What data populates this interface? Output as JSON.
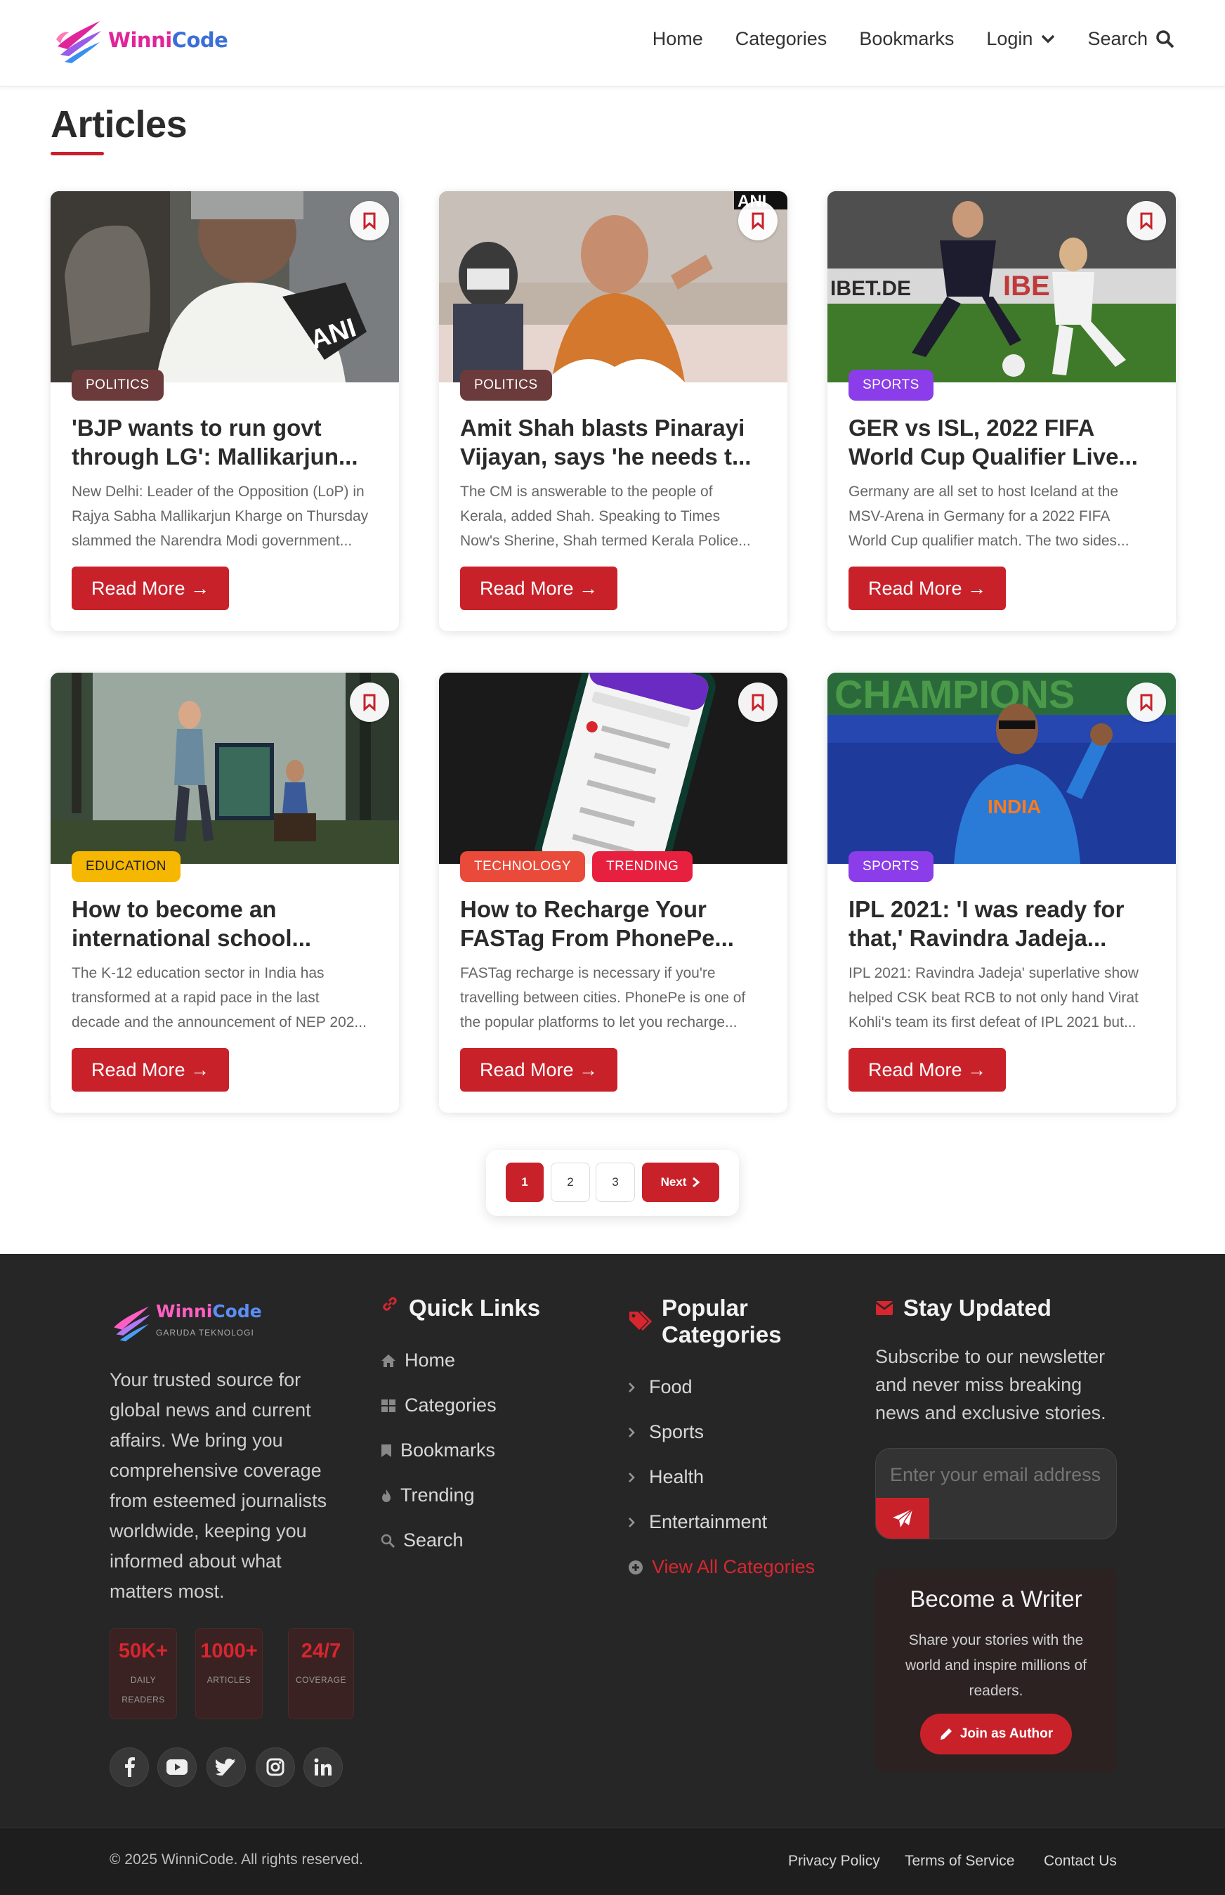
{
  "brand": {
    "name_part1": "Winni",
    "name_part2": "Code",
    "subtitle": "GARUDA TEKNOLOGI"
  },
  "nav": {
    "home": "Home",
    "categories": "Categories",
    "bookmarks": "Bookmarks",
    "login": "Login",
    "search": "Search"
  },
  "page": {
    "title": "Articles"
  },
  "articles": [
    {
      "tags": [
        "POLITICS"
      ],
      "tag_colors": [
        "#6b3b3b"
      ],
      "title_lines": [
        "'BJP wants to run govt",
        "through LG': Mallikarjun..."
      ],
      "excerpt_lines": [
        "New Delhi: Leader of the Opposition (LoP) in",
        "Rajya Sabha Mallikarjun Kharge on Thursday",
        "slammed the Narendra Modi government..."
      ],
      "read_more": "Read More →"
    },
    {
      "tags": [
        "POLITICS"
      ],
      "tag_colors": [
        "#6b3b3b"
      ],
      "title_lines": [
        "Amit Shah blasts Pinarayi",
        "Vijayan, says 'he needs t..."
      ],
      "excerpt_lines": [
        "The CM is answerable to the people of",
        "Kerala, added Shah. Speaking to Times",
        "Now's Sherine, Shah termed Kerala Police..."
      ],
      "read_more": "Read More →"
    },
    {
      "tags": [
        "SPORTS"
      ],
      "tag_colors": [
        "#8a3de8"
      ],
      "title_lines": [
        "GER vs ISL, 2022 FIFA",
        "World Cup Qualifier Live..."
      ],
      "excerpt_lines": [
        "Germany are all set to host Iceland at the",
        "MSV-Arena in Germany for a 2022 FIFA",
        "World Cup qualifier match. The two sides..."
      ],
      "read_more": "Read More →"
    },
    {
      "tags": [
        "EDUCATION"
      ],
      "tag_colors": [
        "#f5b700"
      ],
      "title_lines": [
        "How to become an",
        "international school..."
      ],
      "excerpt_lines": [
        "The K-12 education sector in India has",
        "transformed at a rapid pace in the last",
        "decade and the announcement of NEP 202..."
      ],
      "read_more": "Read More →"
    },
    {
      "tags": [
        "TECHNOLOGY",
        "TRENDING"
      ],
      "tag_colors": [
        "#e94a3a",
        "#e8203f"
      ],
      "title_lines": [
        "How to Recharge Your",
        "FASTag From PhonePe..."
      ],
      "excerpt_lines": [
        "FASTag recharge is necessary if you're",
        "travelling between cities. PhonePe is one of",
        "the popular platforms to let you recharge..."
      ],
      "read_more": "Read More →"
    },
    {
      "tags": [
        "SPORTS"
      ],
      "tag_colors": [
        "#8a3de8"
      ],
      "title_lines": [
        "IPL 2021: 'I was ready for",
        "that,' Ravindra Jadeja..."
      ],
      "excerpt_lines": [
        "IPL 2021: Ravindra Jadeja' superlative show",
        "helped CSK beat RCB to not only hand Virat",
        "Kohli's team its first defeat of IPL 2021 but..."
      ],
      "read_more": "Read More →"
    }
  ],
  "pagination": {
    "pages": [
      "1",
      "2",
      "3"
    ],
    "current": "1",
    "next": "Next"
  },
  "footer": {
    "about": "Your trusted source for global news and current affairs. We bring you comprehensive coverage from esteemed journalists worldwide, keeping you informed about what matters most.",
    "stats": [
      {
        "value": "50K+",
        "label_lines": [
          "DAILY",
          "READERS"
        ]
      },
      {
        "value": "1000+",
        "label_lines": [
          "ARTICLES"
        ]
      },
      {
        "value": "24/7",
        "label_lines": [
          "COVERAGE"
        ]
      }
    ],
    "socials": [
      "facebook-icon",
      "youtube-icon",
      "twitter-icon",
      "instagram-icon",
      "linkedin-icon"
    ],
    "quick_links": {
      "heading": "Quick Links",
      "items": [
        "Home",
        "Categories",
        "Bookmarks",
        "Trending",
        "Search"
      ]
    },
    "popular": {
      "heading_lines": [
        "Popular",
        "Categories"
      ],
      "items": [
        "Food",
        "Sports",
        "Health",
        "Entertainment"
      ],
      "view_all": "View All Categories"
    },
    "newsletter": {
      "heading": "Stay Updated",
      "text": "Subscribe to our newsletter and never miss breaking news and exclusive stories.",
      "placeholder": "Enter your email address"
    },
    "writer": {
      "title": "Become a Writer",
      "text": "Share your stories with the world and inspire millions of readers.",
      "button": "Join as Author"
    },
    "copyright": "© 2025 WinniCode. All rights reserved.",
    "legal": [
      "Privacy Policy",
      "Terms of Service",
      "Contact Us"
    ]
  },
  "colors": {
    "accent": "#c9212a",
    "footer_bg": "#262626"
  }
}
